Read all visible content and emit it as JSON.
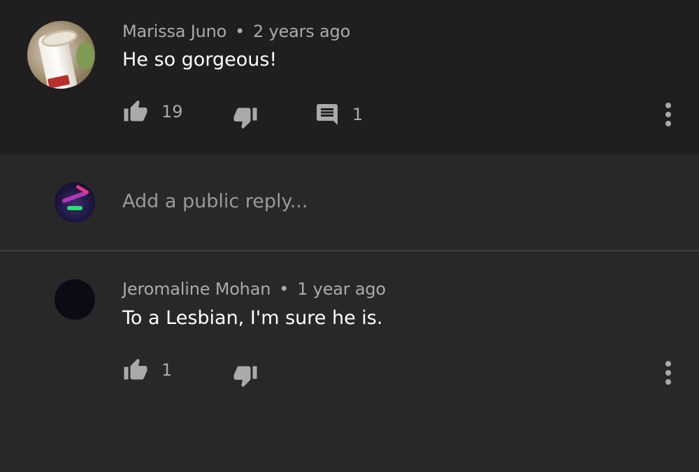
{
  "comment": {
    "author": "Marissa Juno",
    "time": "2 years ago",
    "text": "He so gorgeous!",
    "likes": "19",
    "replies": "1",
    "icons": [
      "thumbs-up-icon",
      "thumbs-down-icon",
      "reply-icon",
      "more-vertical-icon"
    ]
  },
  "reply_box": {
    "placeholder": "Add a public reply..."
  },
  "reply": {
    "author": "Jeromaline Mohan",
    "time": "1 year ago",
    "text": "To a Lesbian, I'm sure he is.",
    "likes": "1",
    "icons": [
      "thumbs-up-icon",
      "thumbs-down-icon",
      "more-vertical-icon"
    ]
  },
  "colors": {
    "background": "#282828",
    "comment_background": "#1f1f1f",
    "meta_text": "#aaaaaa",
    "icon": "#aaaaaa",
    "text": "#ffffff"
  }
}
